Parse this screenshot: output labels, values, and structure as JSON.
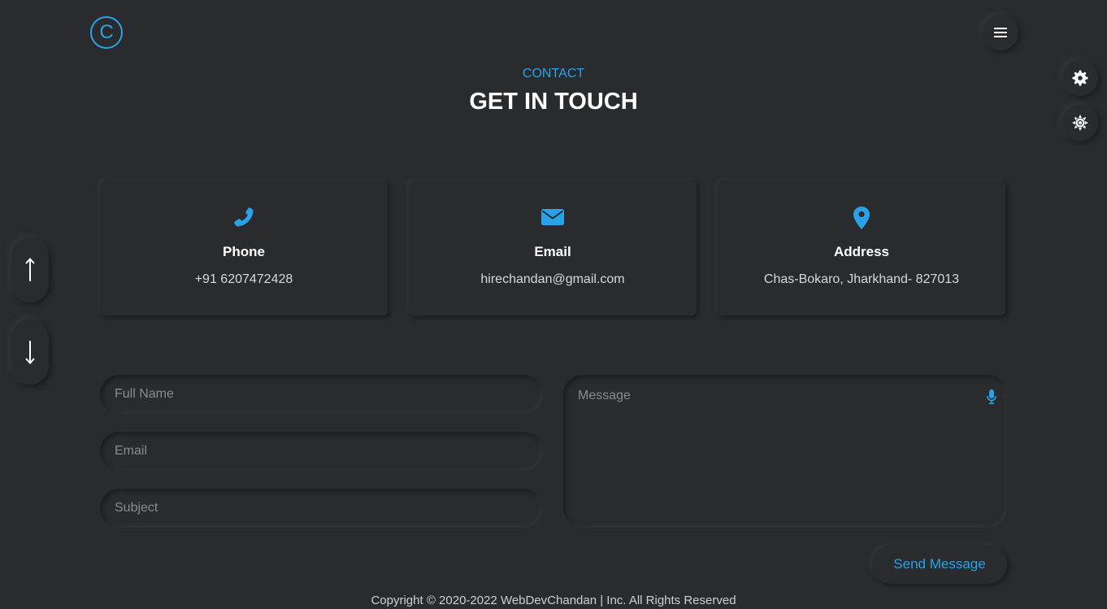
{
  "header": {
    "logo_letter": "C"
  },
  "section": {
    "subtitle": "CONTACT",
    "title": "GET IN TOUCH"
  },
  "cards": [
    {
      "icon": "phone-icon",
      "label": "Phone",
      "value": "+91 6207472428"
    },
    {
      "icon": "envelope-icon",
      "label": "Email",
      "value": "hirechandan@gmail.com"
    },
    {
      "icon": "map-pin-icon",
      "label": "Address",
      "value": "Chas-Bokaro, Jharkhand- 827013"
    }
  ],
  "form": {
    "name_placeholder": "Full Name",
    "email_placeholder": "Email",
    "subject_placeholder": "Subject",
    "message_placeholder": "Message",
    "send_label": "Send Message"
  },
  "footer": {
    "copyright": "Copyright © 2020-2022 WebDevChandan | Inc. All Rights Reserved"
  },
  "side_controls": {
    "up_glyph": "↑",
    "down_glyph": "↓"
  },
  "colors": {
    "background": "#2a2b2f",
    "accent": "#29a3e8",
    "text": "#ffffff"
  }
}
